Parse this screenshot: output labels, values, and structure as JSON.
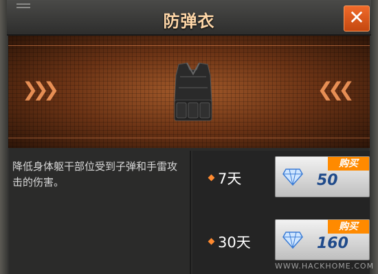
{
  "dialog": {
    "title": "防弹衣",
    "close_label": "✕"
  },
  "item": {
    "name_icon": "bulletproof-vest-icon",
    "description": "降低身体躯干部位受到子弹和手雷攻击的伤害。"
  },
  "purchase_options": [
    {
      "duration": "7天",
      "buy_label": "购买",
      "price": "50",
      "currency_icon": "diamond-icon"
    },
    {
      "duration": "30天",
      "buy_label": "购买",
      "price": "160",
      "currency_icon": "diamond-icon"
    }
  ],
  "watermark": {
    "text": "WWW.HACKHOME.COM"
  },
  "colors": {
    "accent": "#f06a2a",
    "title": "#ffd7a8",
    "price": "#1f4a8a",
    "buy_tag": "#ff8a00"
  }
}
